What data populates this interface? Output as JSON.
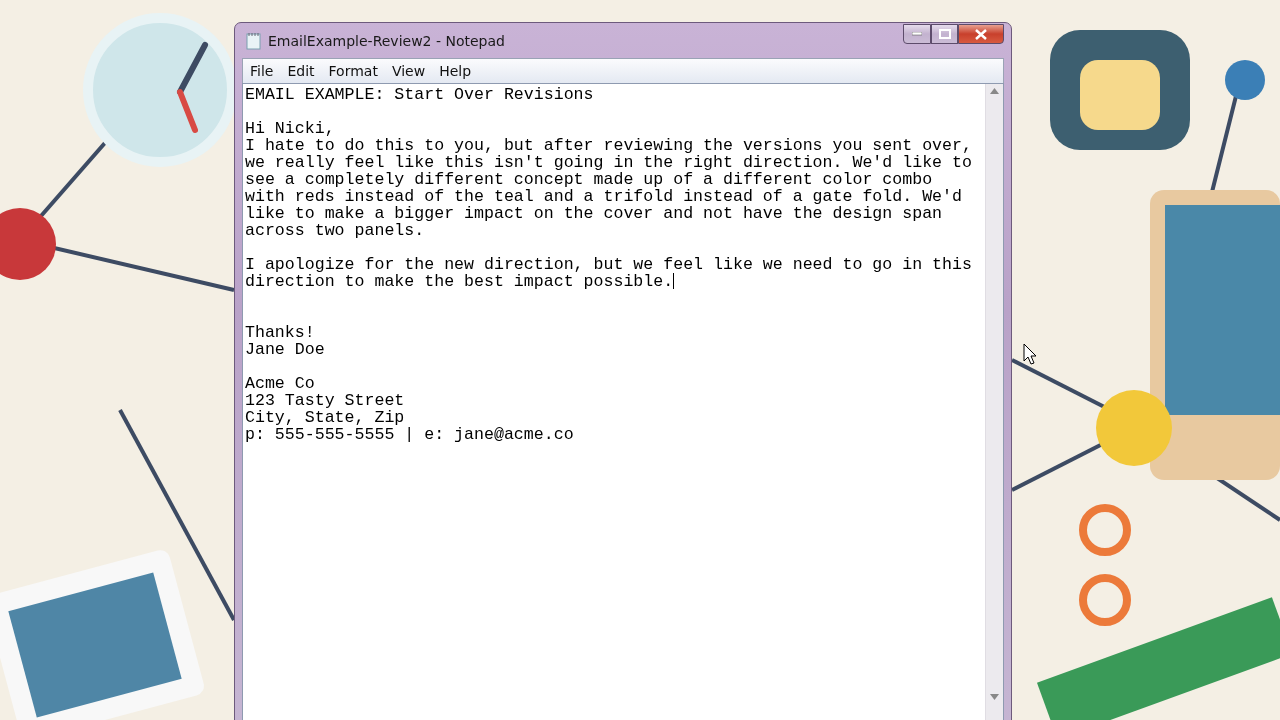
{
  "window": {
    "title": "EmailExample-Review2 - Notepad",
    "active": true
  },
  "menu": [
    "File",
    "Edit",
    "Format",
    "View",
    "Help"
  ],
  "document": [
    {
      "kind": "heading",
      "has_caret": false,
      "lines": [
        "EMAIL EXAMPLE: Start Over Revisions"
      ]
    },
    {
      "kind": "paragraph",
      "has_caret": false,
      "lines": [
        "Hi Nicki,",
        "I hate to do this to you, but after reviewing the versions you sent over,",
        "we really feel like this isn't going in the right direction. We'd like to",
        "see a completely different concept made up of a different color combo",
        "with reds instead of the teal and a trifold instead of a gate fold. We'd",
        "like to make a bigger impact on the cover and not have the design span",
        "across two panels."
      ]
    },
    {
      "kind": "paragraph",
      "has_caret": true,
      "lines": [
        "I apologize for the new direction, but we feel like we need to go in this",
        "direction to make the best impact possible."
      ]
    },
    {
      "kind": "signoff",
      "has_caret": false,
      "lines": [
        "Thanks!",
        "Jane Doe"
      ]
    },
    {
      "kind": "paragraph",
      "has_caret": false,
      "lines": [
        "Acme Co",
        "123 Tasty Street",
        "City, State, Zip",
        "p: 555-555-5555 | e: jane@acme.co"
      ]
    }
  ]
}
